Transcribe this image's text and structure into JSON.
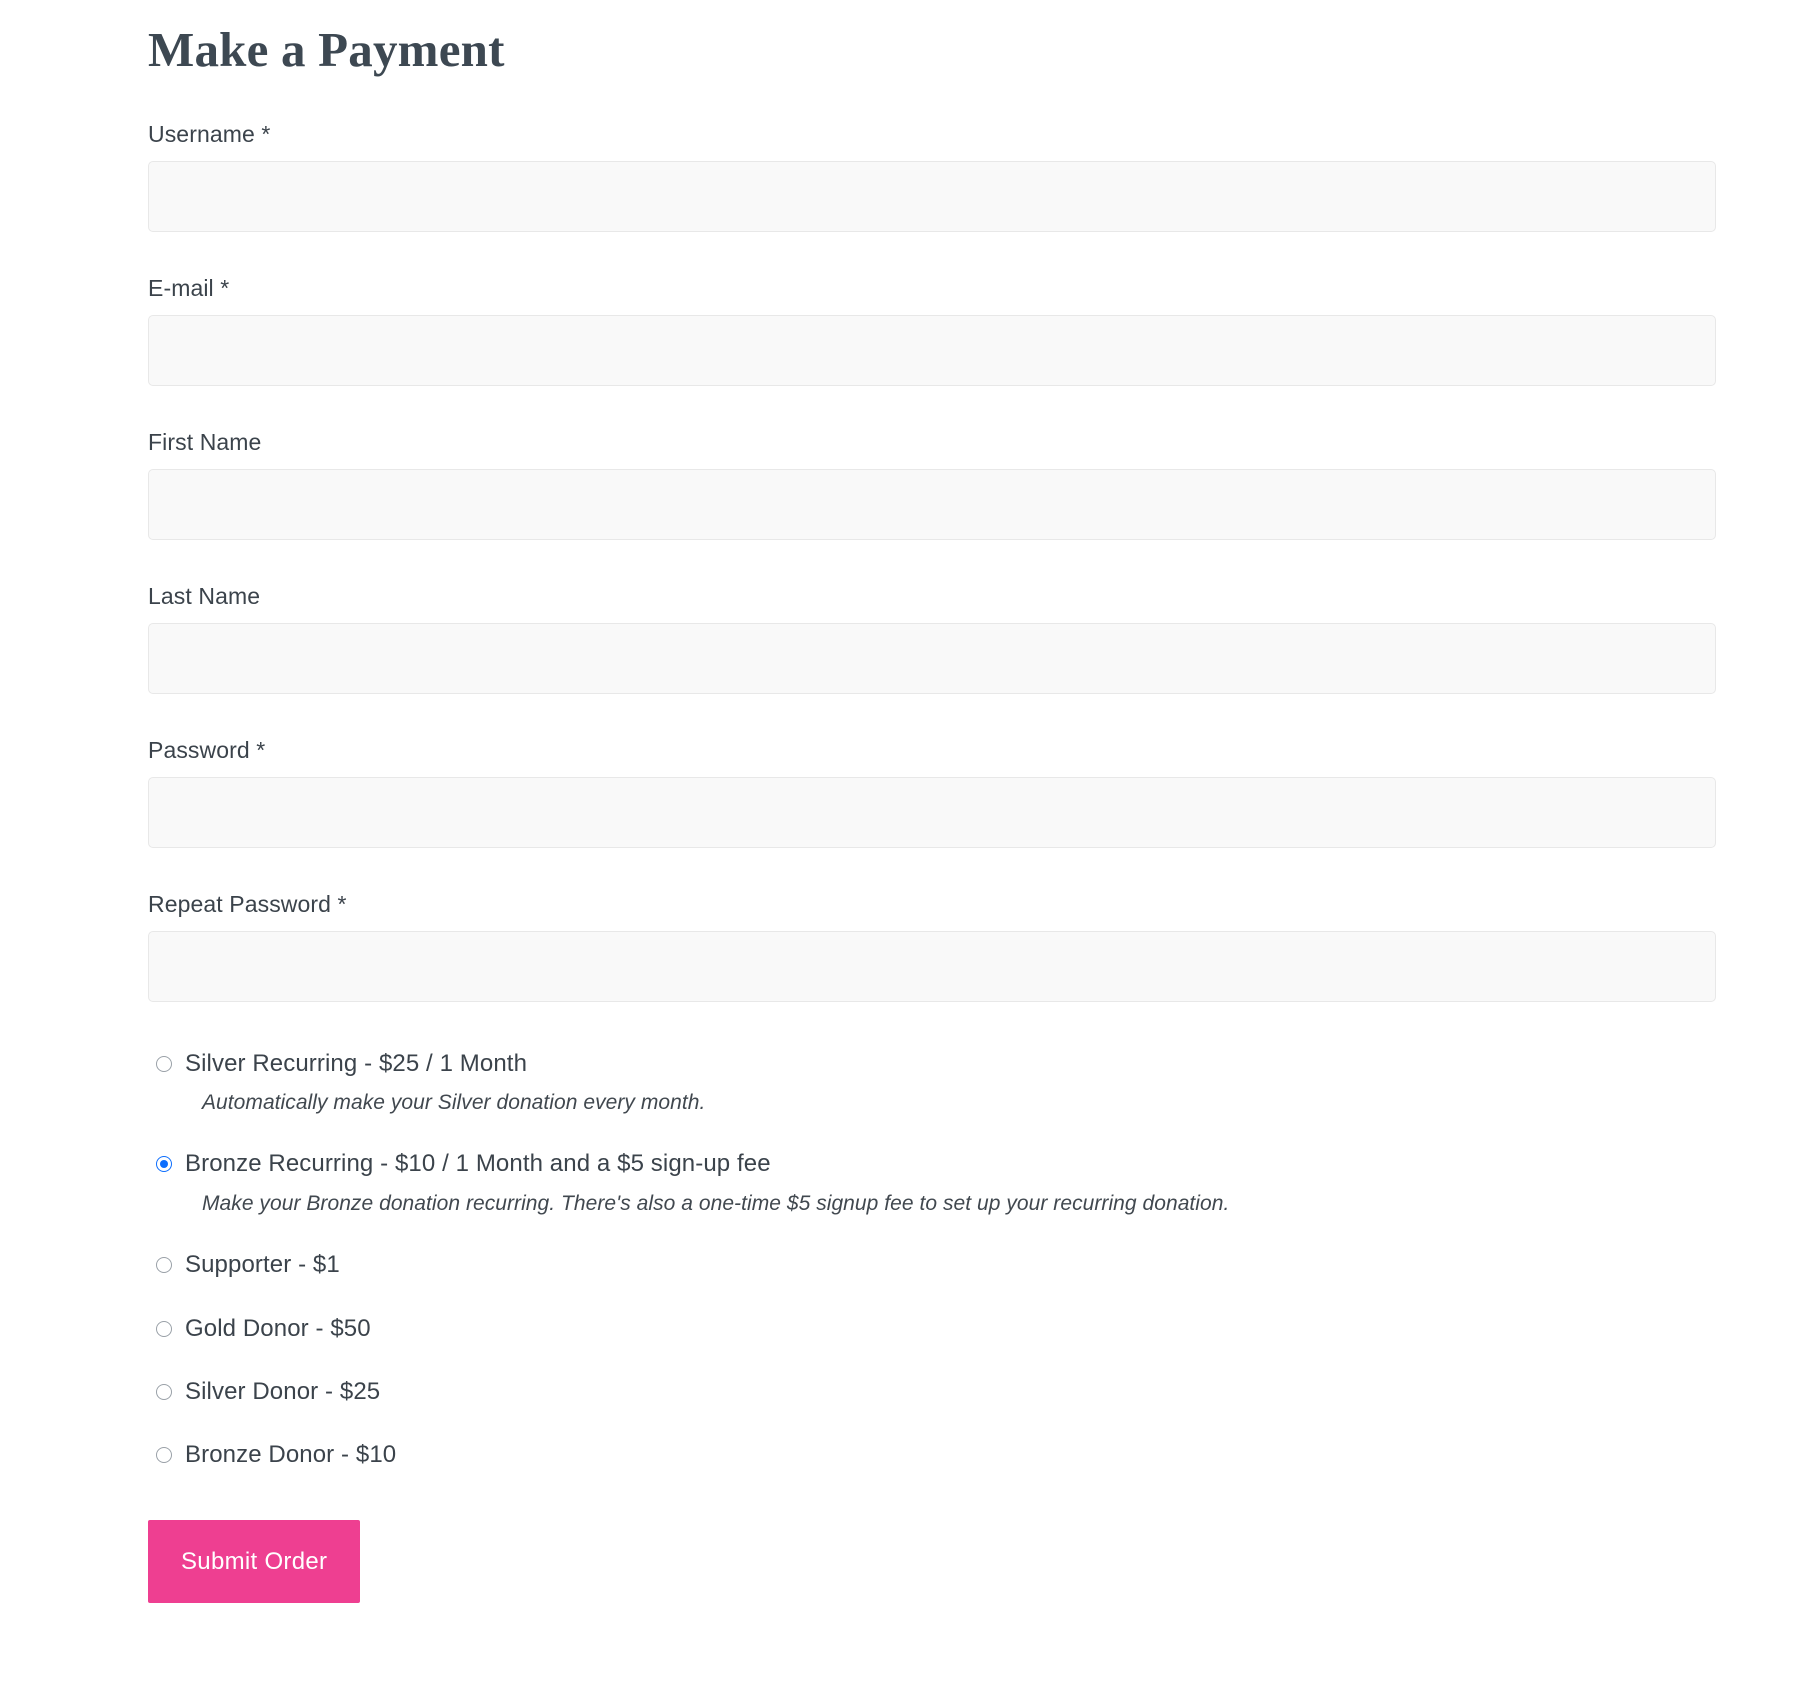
{
  "page": {
    "title": "Make a Payment"
  },
  "fields": [
    {
      "label": "Username *",
      "name": "username-field",
      "type": "text",
      "value": "",
      "placeholder": ""
    },
    {
      "label": "E-mail *",
      "name": "email-field",
      "type": "text",
      "value": "",
      "placeholder": ""
    },
    {
      "label": "First Name",
      "name": "first-name-field",
      "type": "text",
      "value": "",
      "placeholder": ""
    },
    {
      "label": "Last Name",
      "name": "last-name-field",
      "type": "text",
      "value": "",
      "placeholder": ""
    },
    {
      "label": "Password *",
      "name": "password-field",
      "type": "password",
      "value": "",
      "placeholder": ""
    },
    {
      "label": "Repeat Password *",
      "name": "repeat-password-field",
      "type": "password",
      "value": "",
      "placeholder": ""
    }
  ],
  "plans": {
    "options": [
      {
        "label": "Silver Recurring - $25 / 1 Month",
        "description": "Automatically make your Silver donation every month.",
        "selected": false
      },
      {
        "label": "Bronze Recurring - $10 / 1 Month and a $5 sign-up fee",
        "description": "Make your Bronze donation recurring. There's also a one-time $5 signup fee to set up your recurring donation.",
        "selected": true
      },
      {
        "label": "Supporter - $1",
        "description": "",
        "selected": false
      },
      {
        "label": "Gold Donor - $50",
        "description": "",
        "selected": false
      },
      {
        "label": "Silver Donor - $25",
        "description": "",
        "selected": false
      },
      {
        "label": "Bronze Donor - $10",
        "description": "",
        "selected": false
      }
    ]
  },
  "submit": {
    "label": "Submit Order"
  },
  "colors": {
    "accent_pink": "#ee3f91",
    "radio_selected_blue": "#0d6efd",
    "text": "#3b434b",
    "input_background": "#f9f9f9",
    "input_border": "#e8e8e8"
  }
}
